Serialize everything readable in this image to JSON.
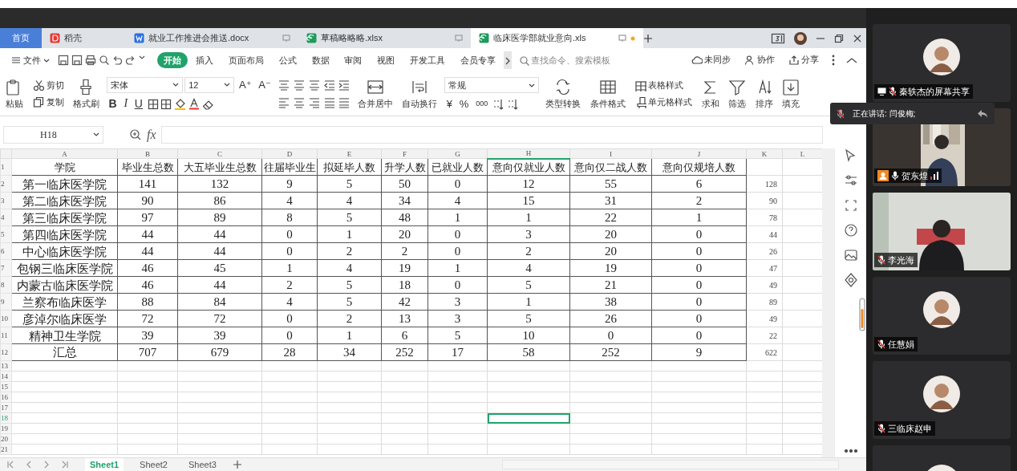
{
  "doc_tabs": [
    {
      "label": "首页",
      "kind": "home",
      "selected": false
    },
    {
      "label": "稻壳",
      "kind": "brand",
      "selected": false
    },
    {
      "label": "就业工作推进会推送.docx",
      "kind": "doc",
      "selected": false
    },
    {
      "label": "草稿略略略.xlsx",
      "kind": "sheet",
      "selected": false
    },
    {
      "label": "临床医学部就业意向.xls",
      "kind": "sheet",
      "selected": true,
      "unsaved": true
    }
  ],
  "menu": {
    "file": "文件",
    "tabs": [
      {
        "label": "开始",
        "selected": true
      },
      {
        "label": "插入",
        "selected": false
      },
      {
        "label": "页面布局",
        "selected": false
      },
      {
        "label": "公式",
        "selected": false
      },
      {
        "label": "数据",
        "selected": false
      },
      {
        "label": "审阅",
        "selected": false
      },
      {
        "label": "视图",
        "selected": false
      },
      {
        "label": "开发工具",
        "selected": false
      },
      {
        "label": "会员专享",
        "selected": false
      }
    ],
    "search_placeholder": "查找命令、搜索模板",
    "sync": "未同步",
    "collaborate": "协作",
    "share": "分享"
  },
  "ribbon": {
    "paste": "粘贴",
    "cut": "剪切",
    "copy": "复制",
    "format_painter": "格式刷",
    "font": "宋体",
    "font_size": "12",
    "grow_font": "A⁺",
    "shrink_font": "A⁻",
    "bold": "B",
    "italic": "I",
    "underline": "U",
    "merge": "合并居中",
    "wrap": "自动换行",
    "number_format": "常规",
    "currency": "¥",
    "percent": "%",
    "thousands": "000",
    "convert": "类型转换",
    "conditional": "条件格式",
    "table_style": "表格样式",
    "cell_style": "单元格样式",
    "sum": "求和",
    "filter": "筛选",
    "sort": "排序",
    "fill": "填充"
  },
  "formula_bar": {
    "name_box": "H18",
    "fx": "fx"
  },
  "grid": {
    "columns": [
      {
        "letter": "A",
        "selected": false
      },
      {
        "letter": "B",
        "selected": false
      },
      {
        "letter": "C",
        "selected": false
      },
      {
        "letter": "D",
        "selected": false
      },
      {
        "letter": "E",
        "selected": false
      },
      {
        "letter": "F",
        "selected": false
      },
      {
        "letter": "G",
        "selected": false
      },
      {
        "letter": "H",
        "selected": true
      },
      {
        "letter": "I",
        "selected": false
      },
      {
        "letter": "J",
        "selected": false
      },
      {
        "letter": "K",
        "selected": false
      },
      {
        "letter": "L",
        "selected": false
      }
    ],
    "rows": [
      {
        "number": "1",
        "selected": false,
        "cells": [
          "学院",
          "毕业生总数",
          "大五毕业生总数",
          "往届毕业生",
          "拟延毕人数",
          "升学人数",
          "已就业人数",
          "意向仅就业人数",
          "意向仅二战人数",
          "意向仅规培人数"
        ]
      },
      {
        "number": "2",
        "selected": false,
        "cells": [
          "第一临床医学院",
          "141",
          "132",
          "9",
          "5",
          "50",
          "0",
          "12",
          "55",
          "6",
          "128"
        ]
      },
      {
        "number": "3",
        "selected": false,
        "cells": [
          "第二临床医学院",
          "90",
          "86",
          "4",
          "4",
          "34",
          "4",
          "15",
          "31",
          "2",
          "90"
        ]
      },
      {
        "number": "4",
        "selected": false,
        "cells": [
          "第三临床医学院",
          "97",
          "89",
          "8",
          "5",
          "48",
          "1",
          "1",
          "22",
          "1",
          "78"
        ]
      },
      {
        "number": "5",
        "selected": false,
        "cells": [
          "第四临床医学院",
          "44",
          "44",
          "0",
          "1",
          "20",
          "0",
          "3",
          "20",
          "0",
          "44"
        ]
      },
      {
        "number": "6",
        "selected": false,
        "cells": [
          "中心临床医学院",
          "44",
          "44",
          "0",
          "2",
          "2",
          "0",
          "2",
          "20",
          "0",
          "26"
        ]
      },
      {
        "number": "7",
        "selected": false,
        "cells": [
          "包钢三临床医学院",
          "46",
          "45",
          "1",
          "4",
          "19",
          "1",
          "4",
          "19",
          "0",
          "47"
        ]
      },
      {
        "number": "8",
        "selected": false,
        "cells": [
          "内蒙古临床医学院",
          "46",
          "44",
          "2",
          "5",
          "18",
          "0",
          "5",
          "21",
          "0",
          "49"
        ]
      },
      {
        "number": "9",
        "selected": false,
        "cells": [
          "兰察布临床医学",
          "88",
          "84",
          "4",
          "5",
          "42",
          "3",
          "1",
          "38",
          "0",
          "89"
        ]
      },
      {
        "number": "10",
        "selected": false,
        "cells": [
          "彦淖尔临床医学",
          "72",
          "72",
          "0",
          "2",
          "13",
          "3",
          "5",
          "26",
          "0",
          "49"
        ]
      },
      {
        "number": "11",
        "selected": false,
        "cells": [
          "精神卫生学院",
          "39",
          "39",
          "0",
          "1",
          "6",
          "5",
          "10",
          "0",
          "0",
          "22"
        ]
      },
      {
        "number": "12",
        "selected": false,
        "cells": [
          "汇总",
          "707",
          "679",
          "28",
          "34",
          "252",
          "17",
          "58",
          "252",
          "9",
          "622"
        ]
      },
      {
        "number": "13",
        "selected": false
      },
      {
        "number": "14",
        "selected": false
      },
      {
        "number": "15",
        "selected": false
      },
      {
        "number": "16",
        "selected": false
      },
      {
        "number": "17",
        "selected": false
      },
      {
        "number": "18",
        "selected": true
      },
      {
        "number": "19",
        "selected": false
      },
      {
        "number": "20",
        "selected": false
      },
      {
        "number": "21",
        "selected": false
      }
    ]
  },
  "sheets": [
    {
      "label": "Sheet1",
      "selected": true
    },
    {
      "label": "Sheet2",
      "selected": false
    },
    {
      "label": "Sheet3",
      "selected": false
    }
  ],
  "meeting": {
    "speaking": "正在讲话: 闫俊梅;",
    "participants": [
      {
        "name": "秦轶杰的屏幕共享",
        "kind": "avatar",
        "muted": true,
        "sharing": true,
        "host": false
      },
      {
        "name": "贺东煌",
        "kind": "video",
        "muted": false,
        "sharing": false,
        "host": true
      },
      {
        "name": "李光海",
        "kind": "video",
        "muted": true,
        "sharing": false,
        "host": false
      },
      {
        "name": "任慧娟",
        "kind": "avatar",
        "muted": true,
        "sharing": false,
        "host": false
      },
      {
        "name": "三临床赵申",
        "kind": "avatar",
        "muted": true,
        "sharing": false,
        "host": false
      },
      {
        "kind": "avatar"
      }
    ]
  }
}
